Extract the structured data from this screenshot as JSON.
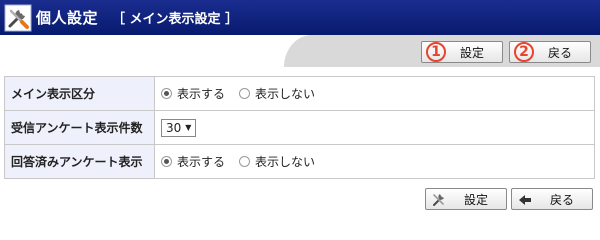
{
  "header": {
    "title": "個人設定",
    "subtitle": "［ メイン表示設定 ］",
    "icon": "tools-icon"
  },
  "toolbar": {
    "save_label": "設定",
    "back_label": "戻る",
    "save_marker": "1",
    "back_marker": "2"
  },
  "settings": {
    "rows": [
      {
        "label": "メイン表示区分",
        "type": "radio",
        "options": [
          "表示する",
          "表示しない"
        ],
        "selected": "表示する"
      },
      {
        "label": "受信アンケート表示件数",
        "type": "select",
        "value": "30"
      },
      {
        "label": "回答済みアンケート表示",
        "type": "radio",
        "options": [
          "表示する",
          "表示しない"
        ],
        "selected": "表示する"
      }
    ]
  },
  "footer": {
    "save_label": "設定",
    "back_label": "戻る",
    "save_icon": "tools-icon",
    "back_icon": "back-arrow-icon"
  },
  "colors": {
    "titlebar": "#0e1f7e",
    "marker": "#e8432c",
    "label_bg": "#eef0fb"
  }
}
